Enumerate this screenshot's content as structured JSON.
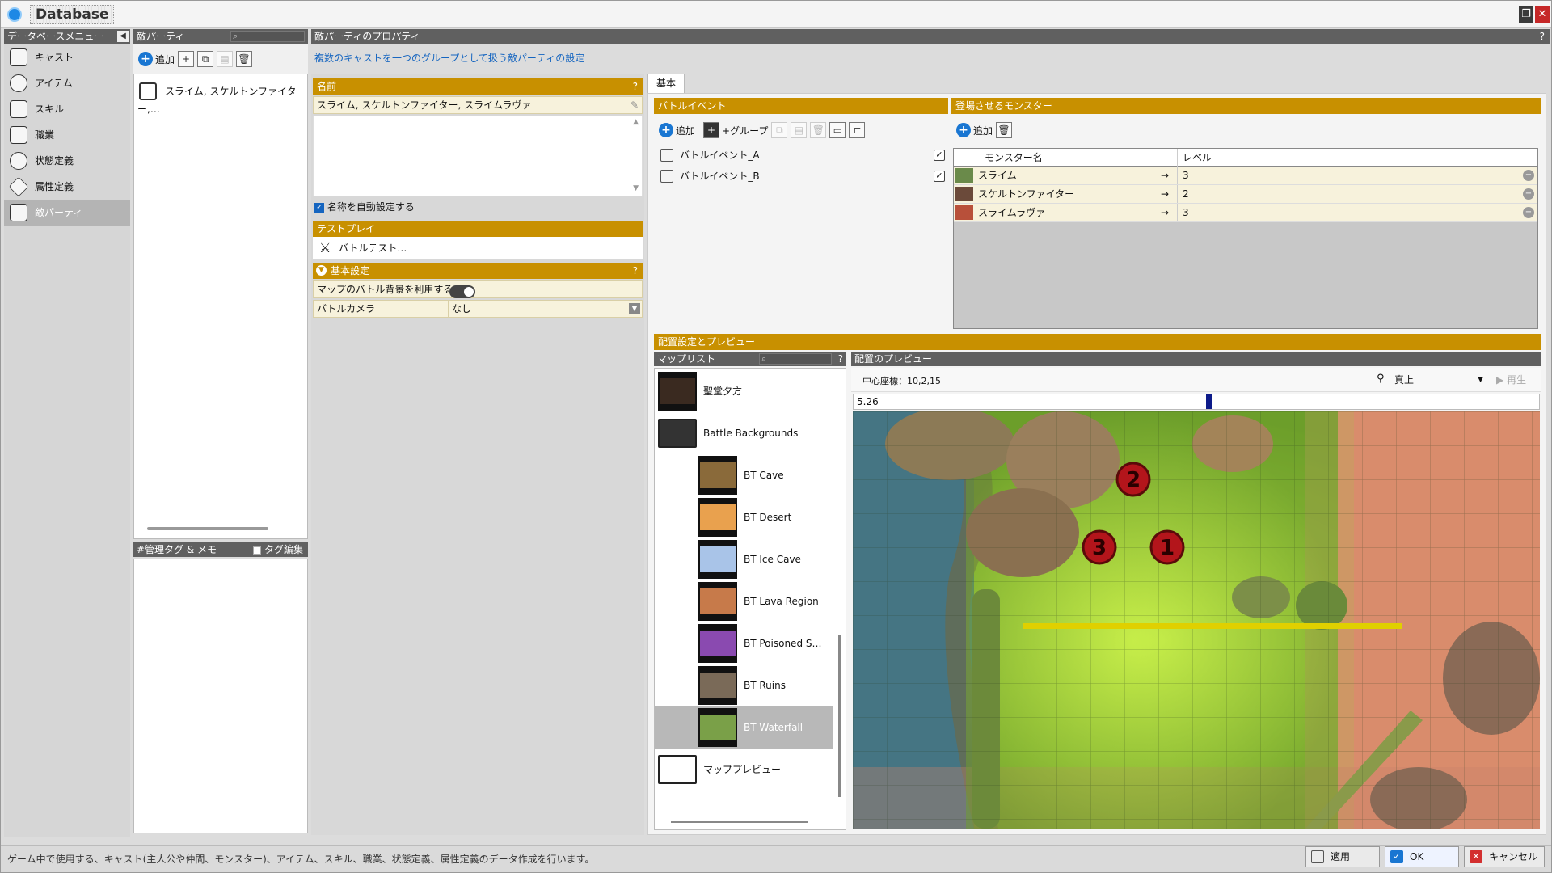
{
  "window": {
    "title": "Database"
  },
  "sidebar": {
    "header": "データベースメニュー",
    "items": [
      {
        "label": "キャスト",
        "icon": "cast-icon"
      },
      {
        "label": "アイテム",
        "icon": "item-icon"
      },
      {
        "label": "スキル",
        "icon": "skill-icon"
      },
      {
        "label": "職業",
        "icon": "job-icon"
      },
      {
        "label": "状態定義",
        "icon": "state-icon"
      },
      {
        "label": "属性定義",
        "icon": "attribute-icon"
      },
      {
        "label": "敵パーティ",
        "icon": "enemy-party-icon"
      }
    ],
    "selected": 6
  },
  "party_list": {
    "header": "敵パーティ",
    "add_label": "追加",
    "items": [
      "スライム, スケルトンファイター,…"
    ]
  },
  "memo": {
    "header": "#管理タグ & メモ",
    "tag_edit_label": "タグ編集"
  },
  "properties": {
    "header": "敵パーティのプロパティ",
    "description": "複数のキャストを一つのグループとして扱う敵パーティの設定",
    "name_header": "名前",
    "name_value": "スライム, スケルトンファイター, スライムラヴァ",
    "auto_name_label": "名称を自動設定する",
    "test_header": "テストプレイ",
    "battle_test_label": "バトルテスト…",
    "basic_header": "基本設定",
    "map_bg_label": "マップのバトル背景を利用する",
    "camera_label": "バトルカメラ",
    "camera_value": "なし"
  },
  "tabs": [
    {
      "label": "基本"
    }
  ],
  "battle_events": {
    "header": "バトルイベント",
    "add_label": "追加",
    "group_label": "+グループ",
    "items": [
      "バトルイベント_A",
      "バトルイベント_B"
    ]
  },
  "monsters": {
    "header": "登場させるモンスター",
    "add_label": "追加",
    "col_name": "モンスター名",
    "col_level": "レベル",
    "rows": [
      {
        "name": "スライム",
        "level": "3"
      },
      {
        "name": "スケルトンファイター",
        "level": "2"
      },
      {
        "name": "スライムラヴァ",
        "level": "3"
      }
    ]
  },
  "placement": {
    "header": "配置設定とプレビュー",
    "maplist_header": "マップリスト",
    "preview_header": "配置のプレビュー",
    "center_coords": "中心座標：10,2,15",
    "view_value": "真上",
    "play_label": "再生",
    "timeline_value": "5.26",
    "maps": [
      {
        "label": "聖堂夕方",
        "indent": 0,
        "kind": "map"
      },
      {
        "label": "Battle Backgrounds",
        "indent": 0,
        "kind": "folder"
      },
      {
        "label": "BT Cave",
        "indent": 1,
        "kind": "map",
        "color": "#8a6a3a"
      },
      {
        "label": "BT Desert",
        "indent": 1,
        "kind": "map",
        "color": "#e9a14e"
      },
      {
        "label": "BT Ice Cave",
        "indent": 1,
        "kind": "map",
        "color": "#a9c4e8"
      },
      {
        "label": "BT Lava Region",
        "indent": 1,
        "kind": "map",
        "color": "#c77a4a"
      },
      {
        "label": "BT Poisoned S…",
        "indent": 1,
        "kind": "map",
        "color": "#8a4ab0"
      },
      {
        "label": "BT Ruins",
        "indent": 1,
        "kind": "map",
        "color": "#7a6a58"
      },
      {
        "label": "BT Waterfall",
        "indent": 1,
        "kind": "map",
        "color": "#7aa048"
      },
      {
        "label": "マッププレビュー",
        "indent": 0,
        "kind": "folder-empty"
      }
    ],
    "selected_map": 8,
    "markers": [
      {
        "label": "2"
      },
      {
        "label": "3"
      },
      {
        "label": "1"
      }
    ]
  },
  "status_bar": "ゲーム中で使用する、キャスト(主人公や仲間、モンスター)、アイテム、スキル、職業、状態定義、属性定義のデータ作成を行います。",
  "footer": {
    "apply_label": "適用",
    "ok_label": "OK",
    "cancel_label": "キャンセル"
  },
  "colors": {
    "accent_gold": "#c89000",
    "header_gray": "#606060",
    "primary_blue": "#1976d2",
    "marker_red": "#b3151b"
  }
}
